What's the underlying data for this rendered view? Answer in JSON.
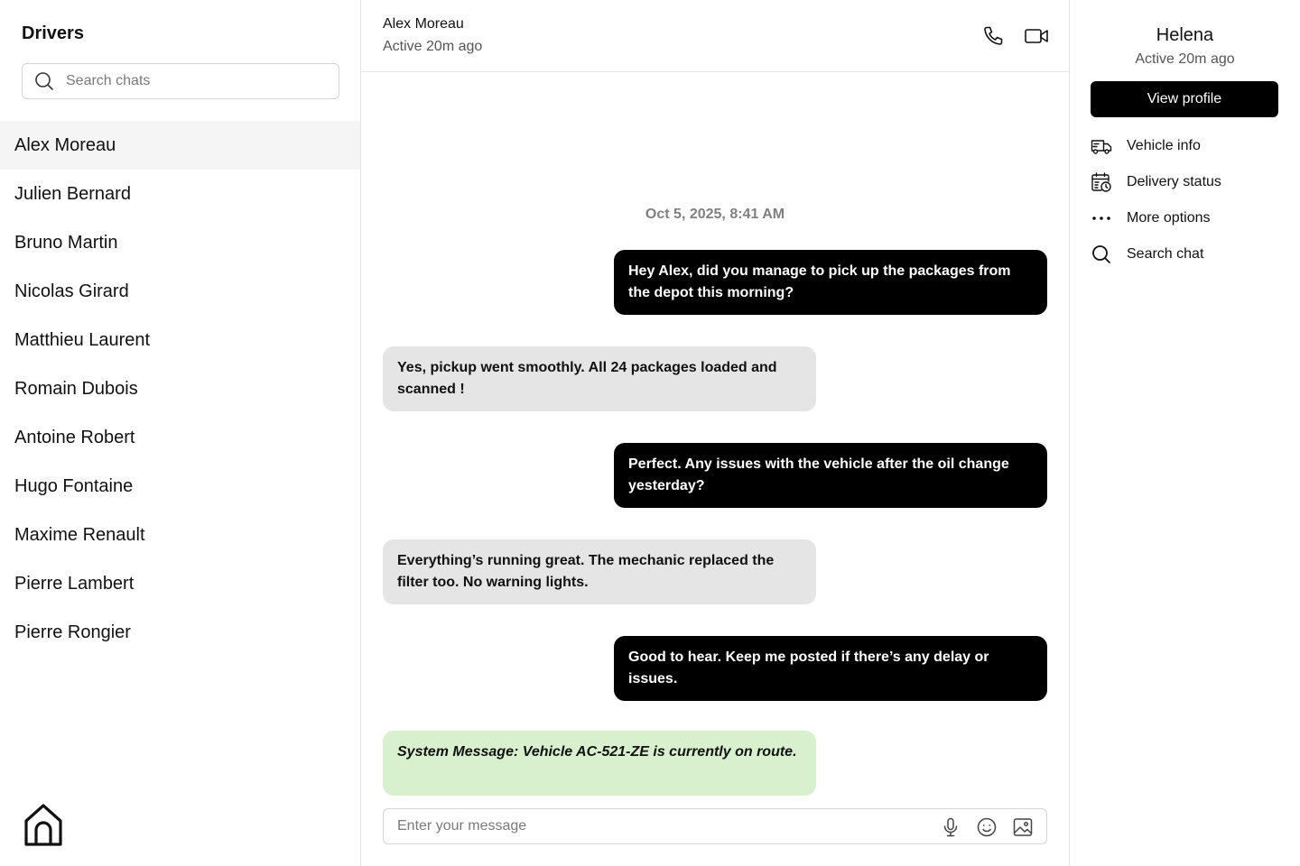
{
  "sidebar": {
    "title": "Drivers",
    "search_placeholder": "Search chats",
    "drivers": [
      {
        "name": "Alex Moreau",
        "active": true
      },
      {
        "name": "Julien Bernard"
      },
      {
        "name": "Bruno Martin"
      },
      {
        "name": "Nicolas Girard"
      },
      {
        "name": "Matthieu Laurent"
      },
      {
        "name": "Romain Dubois"
      },
      {
        "name": "Antoine Robert"
      },
      {
        "name": "Hugo Fontaine"
      },
      {
        "name": "Maxime Renault"
      },
      {
        "name": "Pierre Lambert"
      },
      {
        "name": "Pierre Rongier"
      }
    ],
    "footer_icon": "home-icon"
  },
  "chat": {
    "contact_name": "Alex Moreau",
    "contact_status": "Active 20m ago",
    "header_icons": [
      "phone-icon",
      "video-camera-icon"
    ],
    "date_separator": "Oct 5, 2025, 8:41 AM",
    "messages": [
      {
        "direction": "outgoing",
        "text": "Hey Alex, did you manage to pick up the packages from the depot this morning?"
      },
      {
        "direction": "incoming",
        "text": "Yes, pickup went smoothly. All 24 packages loaded and scanned !"
      },
      {
        "direction": "outgoing",
        "text": "Perfect. Any issues with the vehicle after the oil change yesterday?"
      },
      {
        "direction": "incoming",
        "text": "Everything’s running great. The mechanic replaced the filter too. No warning lights."
      },
      {
        "direction": "outgoing",
        "text": "Good to hear. Keep me posted if there’s any delay or issues."
      },
      {
        "direction": "system",
        "text": "System Message: Vehicle AC-521-ZE is currently on route."
      }
    ],
    "composer": {
      "placeholder": "Enter your message",
      "icons": [
        "microphone-icon",
        "emoji-icon",
        "image-icon"
      ]
    }
  },
  "panel": {
    "name": "Helena",
    "status": "Active 20m ago",
    "view_profile_label": "View profile",
    "menu": [
      {
        "label": "Vehicle info",
        "icon": "delivery-truck-icon"
      },
      {
        "label": "Delivery status",
        "icon": "calendar-clock-icon"
      },
      {
        "label": "More options",
        "icon": "more-dots-icon"
      },
      {
        "label": "Search chat",
        "icon": "search-icon"
      }
    ]
  },
  "colors": {
    "outgoing_bubble": "#000000",
    "incoming_bubble": "#e5e5e5",
    "system_bubble": "#d9f0cf",
    "active_row": "#f5f5f5",
    "primary_button": "#000000"
  }
}
